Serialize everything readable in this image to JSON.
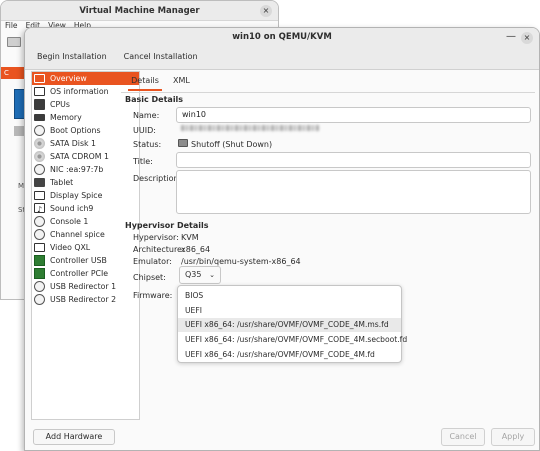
{
  "background_window": {
    "title": "Virtual Machine Manager",
    "menu": [
      "File",
      "Edit",
      "View",
      "Help"
    ],
    "close_glyph": "×",
    "fragments": [
      "C",
      "Me",
      "St"
    ]
  },
  "dialog": {
    "title": "win10 on QEMU/KVM",
    "minimize_glyph": "—",
    "close_glyph": "×",
    "menu": [
      "Begin Installation",
      "Cancel Installation"
    ],
    "add_hardware_label": "Add Hardware",
    "cancel_label": "Cancel",
    "apply_label": "Apply"
  },
  "sidebar": {
    "selected_index": 0,
    "items": [
      {
        "label": "Overview",
        "icon": "monitor-icon"
      },
      {
        "label": "OS information",
        "icon": "info-icon"
      },
      {
        "label": "CPUs",
        "icon": "cpu-icon"
      },
      {
        "label": "Memory",
        "icon": "memory-icon"
      },
      {
        "label": "Boot Options",
        "icon": "gear-icon"
      },
      {
        "label": "SATA Disk 1",
        "icon": "disk-icon"
      },
      {
        "label": "SATA CDROM 1",
        "icon": "cdrom-icon"
      },
      {
        "label": "NIC :ea:97:7b",
        "icon": "network-icon"
      },
      {
        "label": "Tablet",
        "icon": "tablet-icon"
      },
      {
        "label": "Display Spice",
        "icon": "display-icon"
      },
      {
        "label": "Sound ich9",
        "icon": "sound-icon"
      },
      {
        "label": "Console 1",
        "icon": "console-icon"
      },
      {
        "label": "Channel spice",
        "icon": "channel-icon"
      },
      {
        "label": "Video QXL",
        "icon": "video-icon"
      },
      {
        "label": "Controller USB",
        "icon": "controller-icon"
      },
      {
        "label": "Controller PCIe",
        "icon": "controller-icon"
      },
      {
        "label": "USB Redirector 1",
        "icon": "usb-icon"
      },
      {
        "label": "USB Redirector 2",
        "icon": "usb-icon"
      }
    ]
  },
  "tabs": [
    "Details",
    "XML"
  ],
  "basic_details": {
    "heading": "Basic Details",
    "name_label": "Name:",
    "name_value": "win10",
    "uuid_label": "UUID:",
    "status_label": "Status:",
    "status_value": "Shutoff (Shut Down)",
    "title_label": "Title:",
    "title_value": "",
    "description_label": "Description:"
  },
  "hypervisor_details": {
    "heading": "Hypervisor Details",
    "hypervisor_label": "Hypervisor:",
    "hypervisor_value": "KVM",
    "architecture_label": "Architecture:",
    "architecture_value": "x86_64",
    "emulator_label": "Emulator:",
    "emulator_value": "/usr/bin/qemu-system-x86_64",
    "chipset_label": "Chipset:",
    "chipset_value": "Q35",
    "firmware_label": "Firmware:",
    "firmware_options": [
      "BIOS",
      "UEFI",
      "UEFI x86_64: /usr/share/OVMF/OVMF_CODE_4M.ms.fd",
      "UEFI x86_64: /usr/share/OVMF/OVMF_CODE_4M.secboot.fd",
      "UEFI x86_64: /usr/share/OVMF/OVMF_CODE_4M.fd"
    ],
    "firmware_highlighted_index": 2
  }
}
